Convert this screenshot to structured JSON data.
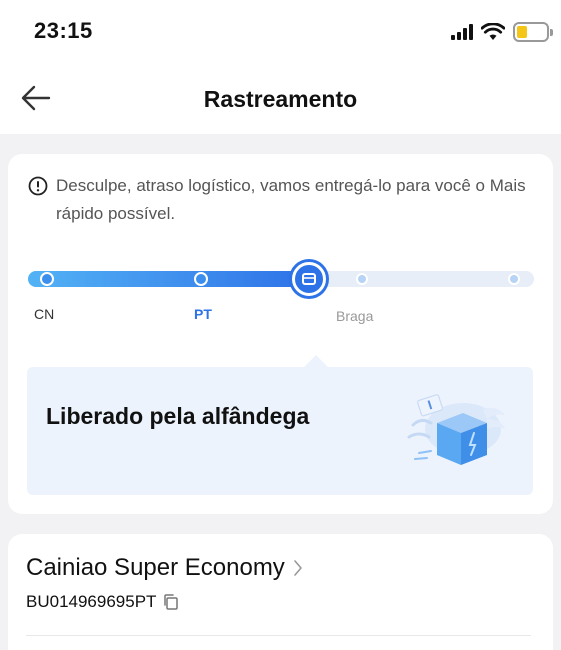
{
  "status_bar": {
    "time": "23:15"
  },
  "header": {
    "title": "Rastreamento",
    "back_icon": "arrow-left-icon"
  },
  "notice": {
    "icon": "alert-circle-icon",
    "text": "Desculpe, atraso logístico, vamos entregá-lo para você o Mais rápido possível."
  },
  "progress": {
    "labels": [
      "CN",
      "PT",
      "Braga"
    ],
    "current_step": 3,
    "total_steps": 5,
    "current_label": "PT"
  },
  "status": {
    "text": "Liberado pela alfândega",
    "illustration": "package-box-icon"
  },
  "shipment": {
    "carrier": "Cainiao Super Economy",
    "tracking_number": "BU014969695PT"
  },
  "colors": {
    "accent": "#2e72e8",
    "accent_light": "#53b2f5",
    "status_bg": "#edf3fc",
    "page_bg": "#f2f2f4"
  }
}
